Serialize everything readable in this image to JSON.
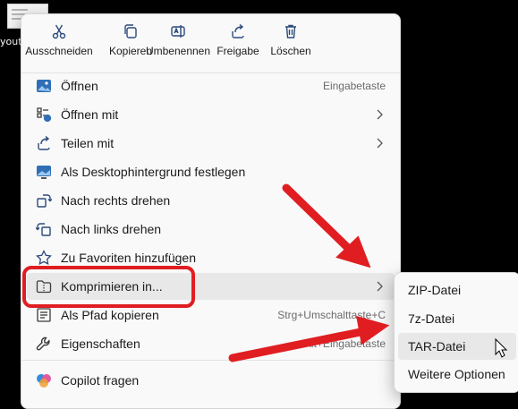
{
  "desktop": {
    "file_label": "yout"
  },
  "toolbar": [
    {
      "label": "Ausschneiden",
      "icon": "scissors-icon"
    },
    {
      "label": "Kopieren",
      "icon": "copy-icon"
    },
    {
      "label": "Umbenennen",
      "icon": "rename-icon"
    },
    {
      "label": "Freigabe",
      "icon": "share-icon"
    },
    {
      "label": "Löschen",
      "icon": "trash-icon"
    }
  ],
  "menu": {
    "items": [
      {
        "label": "Öffnen",
        "shortcut": "Eingabetaste",
        "icon": "image-icon"
      },
      {
        "label": "Öffnen mit",
        "icon": "open-with-icon",
        "submenu": true
      },
      {
        "label": "Teilen mit",
        "icon": "share-icon",
        "submenu": true
      },
      {
        "label": "Als Desktophintergrund festlegen",
        "icon": "desktop-background-icon"
      },
      {
        "label": "Nach rechts drehen",
        "icon": "rotate-right-icon"
      },
      {
        "label": "Nach links drehen",
        "icon": "rotate-left-icon"
      },
      {
        "label": "Zu Favoriten hinzufügen",
        "icon": "star-icon"
      },
      {
        "label": "Komprimieren in...",
        "icon": "zip-folder-icon",
        "submenu": true,
        "highlighted": true
      },
      {
        "label": "Als Pfad kopieren",
        "shortcut": "Strg+Umschalttaste+C",
        "icon": "copy-path-icon"
      },
      {
        "label": "Eigenschaften",
        "shortcut": "Alt+Eingabetaste",
        "icon": "wrench-icon"
      },
      {
        "label": "Copilot fragen",
        "icon": "copilot-icon"
      }
    ]
  },
  "submenu": {
    "items": [
      {
        "label": "ZIP-Datei"
      },
      {
        "label": "7z-Datei"
      },
      {
        "label": "TAR-Datei",
        "highlighted": true
      },
      {
        "label": "Weitere Optionen"
      }
    ]
  },
  "colors": {
    "annotation": "#e01e22",
    "accent": "#2b6fc0",
    "menu_bg": "#f9f9f9",
    "hover": "#e8e8e8"
  }
}
